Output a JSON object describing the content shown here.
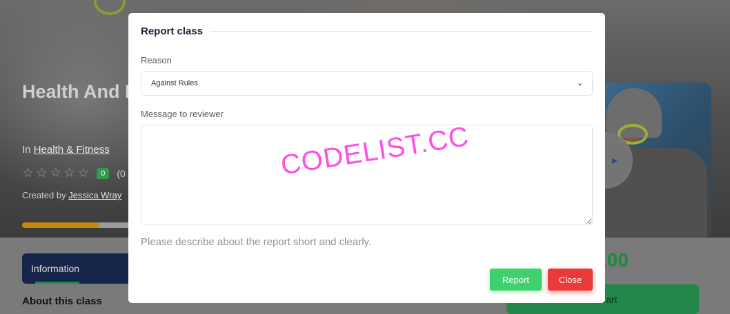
{
  "background": {
    "course_title": "Health And Fitness",
    "category_prefix": "In",
    "category_link": "Health & Fitness",
    "rating_badge": "0",
    "rating_count": "(0",
    "creator_prefix": "Created by",
    "creator_name": "Jessica Wray",
    "progress_fraction": 0.7,
    "info_tab_label": "Information",
    "about_title": "About this class",
    "price": ".00",
    "cart_label": "Cart",
    "play_icon": "play-icon",
    "star_icon": "star-outline-icon"
  },
  "modal": {
    "title": "Report class",
    "reason_label": "Reason",
    "reason_selected": "Against Rules",
    "message_label": "Message to reviewer",
    "message_value": "",
    "helper_text": "Please describe about the report short and clearly.",
    "report_button": "Report",
    "close_button": "Close"
  },
  "watermark": "CODELIST.CC",
  "colors": {
    "report": "#3ed16e",
    "close": "#ea3a3a",
    "info_tab": "#16254a",
    "price": "#1b8a3f",
    "watermark": "#ff4fe8"
  }
}
